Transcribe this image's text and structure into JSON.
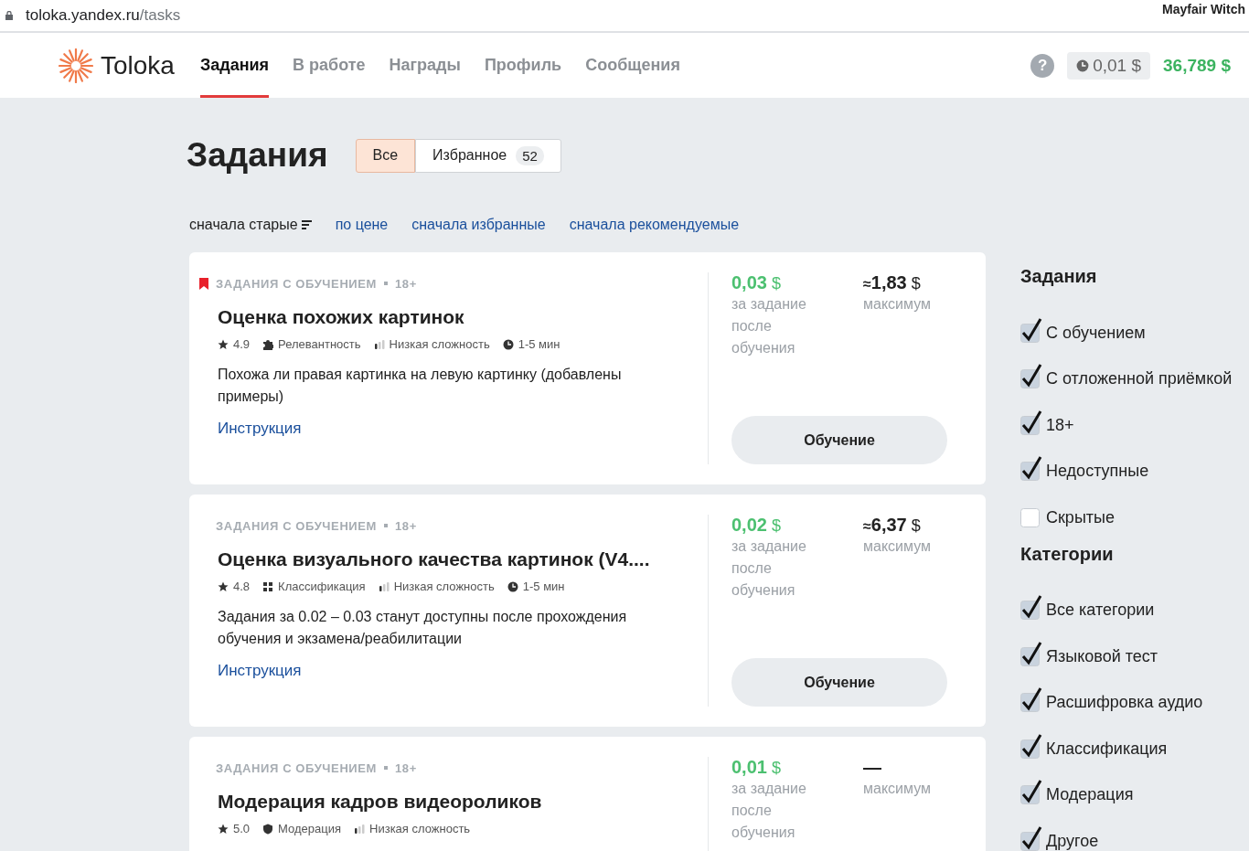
{
  "browser": {
    "url_host": "toloka.yandex.ru",
    "url_path": "/tasks",
    "profile": "Mayfair Witch"
  },
  "header": {
    "logo": "Toloka",
    "nav": [
      {
        "label": "Задания",
        "selected": true
      },
      {
        "label": "В работе",
        "selected": false
      },
      {
        "label": "Награды",
        "selected": false
      },
      {
        "label": "Профиль",
        "selected": false
      },
      {
        "label": "Сообщения",
        "selected": false
      }
    ],
    "help": "?",
    "pending": "0,01 $",
    "balance": "36,789 $"
  },
  "page": {
    "title": "Задания",
    "tabs": [
      {
        "label": "Все",
        "selected": true
      },
      {
        "label": "Избранное",
        "count": "52",
        "selected": false
      }
    ],
    "sort": [
      {
        "label": "сначала старые",
        "selected": true
      },
      {
        "label": "по цене",
        "selected": false
      },
      {
        "label": "сначала избранные",
        "selected": false
      },
      {
        "label": "сначала рекомендуемые",
        "selected": false
      }
    ]
  },
  "tasks": [
    {
      "bookmarked": true,
      "type": "ЗАДАНИЯ С ОБУЧЕНИЕМ",
      "age": "18+",
      "title": "Оценка похожих картинок",
      "stats": [
        {
          "kind": "rating",
          "text": "4.9"
        },
        {
          "kind": "relevance",
          "text": "Релевантность"
        },
        {
          "kind": "difficulty",
          "text": "Низкая сложность"
        },
        {
          "kind": "duration",
          "text": "1-5 мин"
        }
      ],
      "description": "Похожа ли правая картинка на левую картинку (добавлены примеры)",
      "link": "Инструкция",
      "price": "0,03",
      "price_currency": "$",
      "price_note": "за задание после обучения",
      "max_prefix": "≈",
      "max": "1,83",
      "max_currency": "$",
      "max_note": "максимум",
      "button": "Обучение"
    },
    {
      "bookmarked": false,
      "type": "ЗАДАНИЯ С ОБУЧЕНИЕМ",
      "age": "18+",
      "title": "Оценка визуального качества картинок (V4....",
      "stats": [
        {
          "kind": "rating",
          "text": "4.8"
        },
        {
          "kind": "classification",
          "text": "Классификация"
        },
        {
          "kind": "difficulty",
          "text": "Низкая сложность"
        },
        {
          "kind": "duration",
          "text": "1-5 мин"
        }
      ],
      "description": "Задания за 0.02 – 0.03 станут доступны после прохождения обучения и экзамена/реабилитации",
      "link": "Инструкция",
      "price": "0,02",
      "price_currency": "$",
      "price_note": "за задание после обучения",
      "max_prefix": "≈",
      "max": "6,37",
      "max_currency": "$",
      "max_note": "максимум",
      "button": "Обучение"
    },
    {
      "bookmarked": false,
      "type": "ЗАДАНИЯ С ОБУЧЕНИЕМ",
      "age": "18+",
      "title": "Модерация кадров видеороликов",
      "stats": [
        {
          "kind": "rating",
          "text": "5.0"
        },
        {
          "kind": "moderation",
          "text": "Модерация"
        },
        {
          "kind": "difficulty",
          "text": "Низкая сложность"
        }
      ],
      "price": "0,01",
      "price_currency": "$",
      "price_note": "за задание после обучения",
      "max": "—",
      "max_note": "максимум"
    }
  ],
  "filters": [
    {
      "title": "Задания",
      "items": [
        {
          "label": "С обучением",
          "checked": true
        },
        {
          "label": "С отложенной приёмкой",
          "checked": true
        },
        {
          "label": "18+",
          "checked": true
        },
        {
          "label": "Недоступные",
          "checked": true
        },
        {
          "label": "Скрытые",
          "checked": false
        }
      ]
    },
    {
      "title": "Категории",
      "items": [
        {
          "label": "Все категории",
          "checked": true
        },
        {
          "label": "Языковой тест",
          "checked": true
        },
        {
          "label": "Расшифровка аудио",
          "checked": true
        },
        {
          "label": "Классификация",
          "checked": true
        },
        {
          "label": "Модерация",
          "checked": true
        },
        {
          "label": "Другое",
          "checked": true
        }
      ]
    }
  ]
}
